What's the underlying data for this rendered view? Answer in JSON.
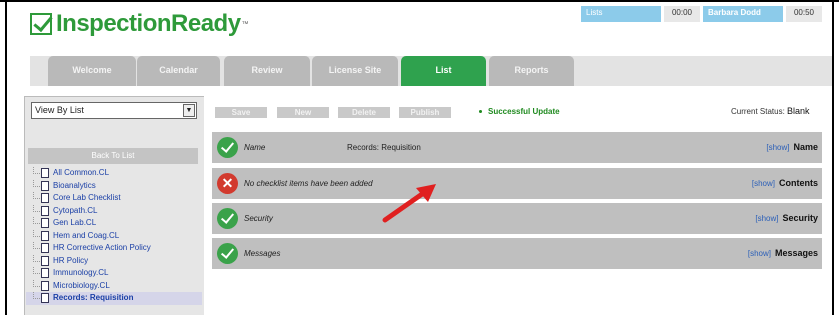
{
  "app": {
    "logo_text": "InspectionReady",
    "logo_tm": "™"
  },
  "top_bar": {
    "lists_label": "Lists",
    "time1": "00:00",
    "user": "Barbara Dodd",
    "time2": "00:50"
  },
  "tabs": [
    {
      "label": "Welcome"
    },
    {
      "label": "Calendar"
    },
    {
      "label": "Review"
    },
    {
      "label": "License Site"
    },
    {
      "label": "List"
    },
    {
      "label": "Reports"
    }
  ],
  "sidebar": {
    "view_select": "View By List",
    "back_to_list": "Back To List",
    "items": [
      "All Common.CL",
      "Bioanalytics",
      "Core Lab Checklist",
      "Cytopath.CL",
      "Gen Lab.CL",
      "Hem and Coag.CL",
      "HR Corrective Action Policy",
      "HR Policy",
      "Immunology.CL",
      "Microbiology.CL",
      "Records: Requisition"
    ]
  },
  "actions": {
    "save": "Save",
    "new": "New",
    "delete": "Delete",
    "publish": "Publish",
    "success_message": "Successful Update",
    "status_label": "Current Status:",
    "status_value": "Blank"
  },
  "rows": [
    {
      "label": "Name",
      "value": "Records: Requisition",
      "show": "[show]",
      "section": "Name"
    },
    {
      "label": "No checklist items have been added",
      "value": "",
      "show": "[show]",
      "section": "Contents"
    },
    {
      "label": "Security",
      "value": "",
      "show": "[show]",
      "section": "Security"
    },
    {
      "label": "Messages",
      "value": "",
      "show": "[show]",
      "section": "Messages"
    }
  ],
  "colors": {
    "brand_green": "#2e9a3a",
    "active_tab": "#2fa24e",
    "error_red": "#d23a2e",
    "link_blue": "#2b5fb8"
  },
  "icons": [
    "check-circle-icon",
    "x-circle-icon",
    "document-icon",
    "red-arrow-annotation"
  ]
}
